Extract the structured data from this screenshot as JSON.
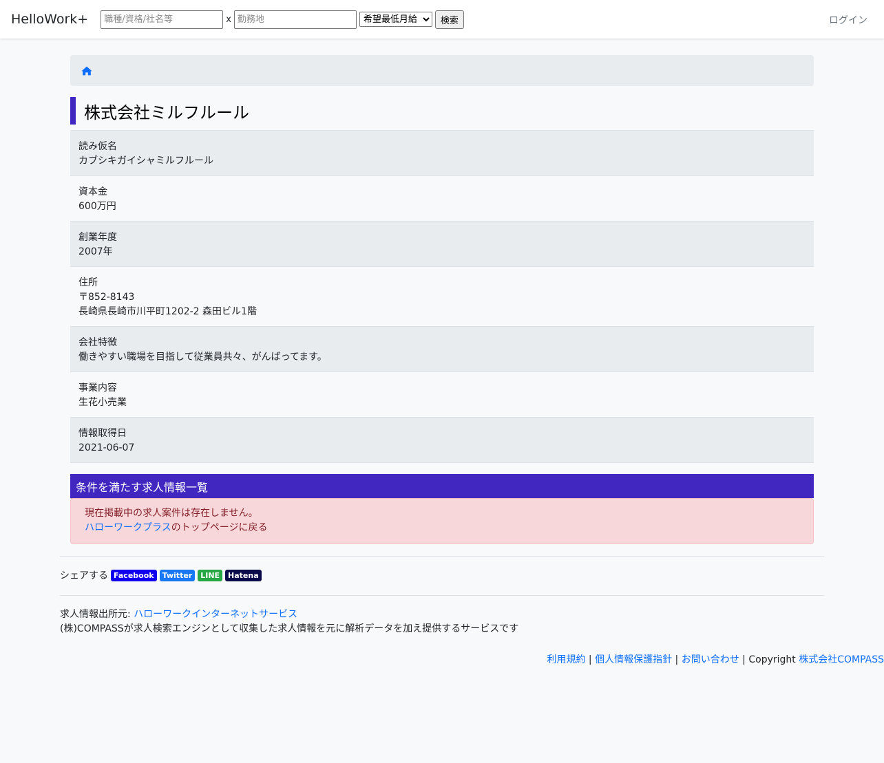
{
  "navbar": {
    "brand": "HelloWork+",
    "keyword_placeholder": "職種/資格/社名等",
    "separator": "x",
    "location_placeholder": "勤務地",
    "salary_select": "希望最低月給",
    "search_button": "検索",
    "login": "ログイン"
  },
  "breadcrumb": {
    "home_icon": "home-icon"
  },
  "company": {
    "name": "株式会社ミルフルール",
    "rows": [
      {
        "label": "読み仮名",
        "value": "カブシキガイシャミルフルール"
      },
      {
        "label": "資本金",
        "value": "600万円"
      },
      {
        "label": "創業年度",
        "value": "2007年"
      },
      {
        "label": "住所",
        "value": "〒852-8143",
        "value2": "長崎県長崎市川平町1202-2 森田ビル1階"
      },
      {
        "label": "会社特徴",
        "value": "働きやすい職場を目指して従業員共々、がんばってます。"
      },
      {
        "label": "事業内容",
        "value": "生花小売業"
      },
      {
        "label": "情報取得日",
        "value": "2021-06-07"
      }
    ]
  },
  "job_list": {
    "header": "条件を満たす求人情報一覧",
    "no_jobs": "現在掲載中の求人案件は存在しません。",
    "top_link": "ハローワークプラス",
    "top_suffix": "のトップページに戻る"
  },
  "share": {
    "label": "シェアする",
    "buttons": [
      {
        "label": "Facebook",
        "color": "#1100ee"
      },
      {
        "label": "Twitter",
        "color": "#1877f2"
      },
      {
        "label": "LINE",
        "color": "#28a745"
      },
      {
        "label": "Hatena",
        "color": "#0a0a4a"
      }
    ]
  },
  "source": {
    "prefix": "求人情報出所元: ",
    "link": "ハローワークインターネットサービス",
    "description": "(株)COMPASSが求人検索エンジンとして収集した求人情報を元に解析データを加え提供するサービスです"
  },
  "footer": {
    "terms": "利用規約",
    "privacy": "個人情報保護指針",
    "contact": "お問い合わせ",
    "sep": " | ",
    "copyright": "Copyright ",
    "company_link": "株式会社COMPASS"
  },
  "colors": {
    "title_accent": "#3f27c0",
    "section_header": "#4127c0",
    "alert_bg": "#f8d7da",
    "link": "#0d6efd"
  }
}
